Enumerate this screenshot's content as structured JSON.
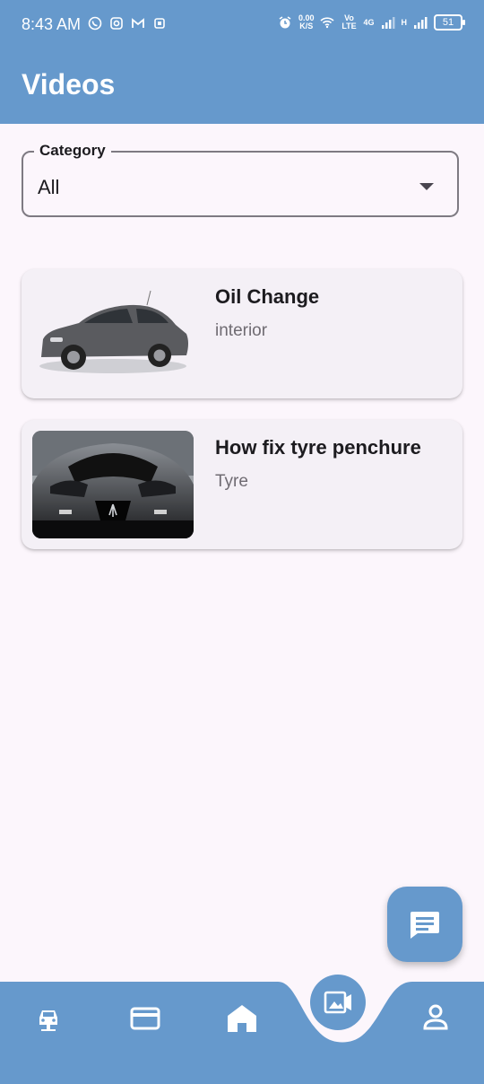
{
  "status_bar": {
    "time": "8:43 AM",
    "net_speed_value": "0.00",
    "net_speed_unit": "K/S",
    "volte": "Vo LTE",
    "network_4g": "4G",
    "network_h": "H",
    "battery": "51"
  },
  "app_bar": {
    "title": "Videos"
  },
  "category_filter": {
    "label": "Category",
    "value": "All"
  },
  "videos": [
    {
      "title": "Oil Change",
      "category": "interior",
      "thumbnail": "silver-hatchback-car-image"
    },
    {
      "title": "How fix tyre penchure",
      "category": "Tyre",
      "thumbnail": "black-sports-car-image"
    }
  ],
  "fab": {
    "icon": "chat-icon"
  },
  "bottom_nav": {
    "items": [
      "car-icon",
      "credit-card-icon",
      "home-icon",
      "video-gallery-icon",
      "person-icon"
    ],
    "active": "video-gallery-icon"
  },
  "colors": {
    "primary": "#6699cc",
    "background": "#fcf6fc",
    "card": "#f4f0f6"
  }
}
